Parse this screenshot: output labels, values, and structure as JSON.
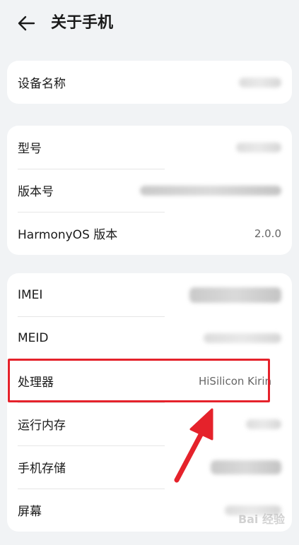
{
  "header": {
    "title": "关于手机",
    "back_icon": "arrow-left-icon"
  },
  "card_device": {
    "items": [
      {
        "label": "设备名称",
        "value": ""
      }
    ]
  },
  "card_version": {
    "items": [
      {
        "label": "型号",
        "value": ""
      },
      {
        "label": "版本号",
        "value": ""
      },
      {
        "label": "HarmonyOS 版本",
        "value": "2.0.0"
      }
    ]
  },
  "card_hardware": {
    "items": [
      {
        "label": "IMEI",
        "value": ""
      },
      {
        "label": "MEID",
        "value": ""
      },
      {
        "label": "处理器",
        "value": "HiSilicon Kirin"
      },
      {
        "label": "运行内存",
        "value": ""
      },
      {
        "label": "手机存储",
        "value": ""
      },
      {
        "label": "屏幕",
        "value": ""
      }
    ]
  },
  "annotation": {
    "highlight_color": "#e5222b"
  },
  "watermark": {
    "text": "Bai 经验"
  }
}
